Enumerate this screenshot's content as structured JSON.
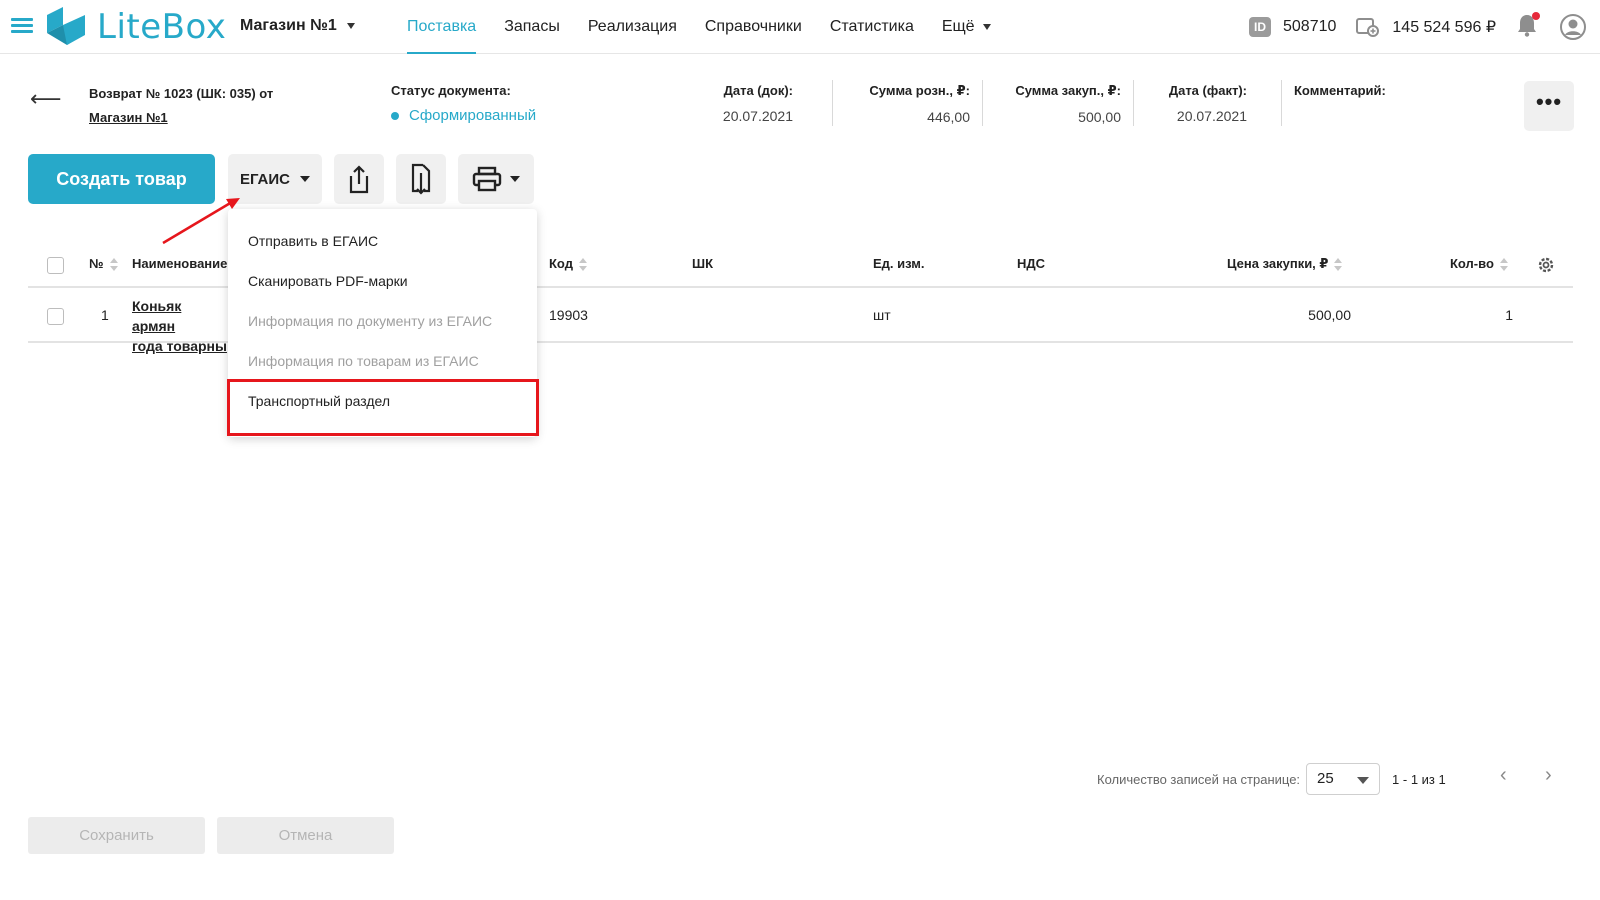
{
  "app": {
    "logo_text": "LiteBox",
    "store": "Магазин №1",
    "nav": [
      {
        "label": "Поставка",
        "active": true
      },
      {
        "label": "Запасы"
      },
      {
        "label": "Реализация"
      },
      {
        "label": "Справочники"
      },
      {
        "label": "Статистика"
      },
      {
        "label": "Ещё"
      }
    ],
    "id_badge": "ID",
    "account_id": "508710",
    "balance": "145 524 596 ₽",
    "accent_color": "#27a9c9"
  },
  "document": {
    "title": "Возврат № 1023 (ШК: 035) от",
    "store_link": "Магазин №1",
    "status_label": "Статус документа:",
    "status_value": "Сформированный",
    "date_doc_label": "Дата (док):",
    "date_doc_value": "20.07.2021",
    "sum_retail_label": "Сумма розн., ₽:",
    "sum_retail_value": "446,00",
    "sum_purchase_label": "Сумма закуп., ₽:",
    "sum_purchase_value": "500,00",
    "date_fact_label": "Дата (факт):",
    "date_fact_value": "20.07.2021",
    "comment_label": "Комментарий:",
    "more_label": "•••"
  },
  "toolbar": {
    "create_label": "Создать товар",
    "egais_label": "ЕГАИС"
  },
  "dropdown": {
    "items": [
      {
        "label": "Отправить в ЕГАИС",
        "disabled": false
      },
      {
        "label": "Сканировать PDF-марки",
        "disabled": false
      },
      {
        "label": "Информация по документу из ЕГАИС",
        "disabled": true
      },
      {
        "label": "Информация по товарам из ЕГАИС",
        "disabled": true
      },
      {
        "label": "Транспортный раздел",
        "disabled": false
      }
    ],
    "highlight_color": "#e6161c"
  },
  "table": {
    "columns": [
      "№",
      "Наименование",
      "Код",
      "ШК",
      "Ед. изм.",
      "НДС",
      "Цена закупки, ₽",
      "Кол-во"
    ],
    "rows": [
      {
        "num": "1",
        "name_line1": "Коньяк армян",
        "name_line2": "года товарны",
        "code": "19903",
        "barcode": "",
        "unit": "шт",
        "vat": "",
        "price": "500,00",
        "qty": "1"
      }
    ]
  },
  "pagination": {
    "label": "Количество записей на странице:",
    "page_size": "25",
    "range": "1 - 1 из 1",
    "prev": "‹",
    "next": "›"
  },
  "footer": {
    "save_label": "Сохранить",
    "cancel_label": "Отмена"
  }
}
